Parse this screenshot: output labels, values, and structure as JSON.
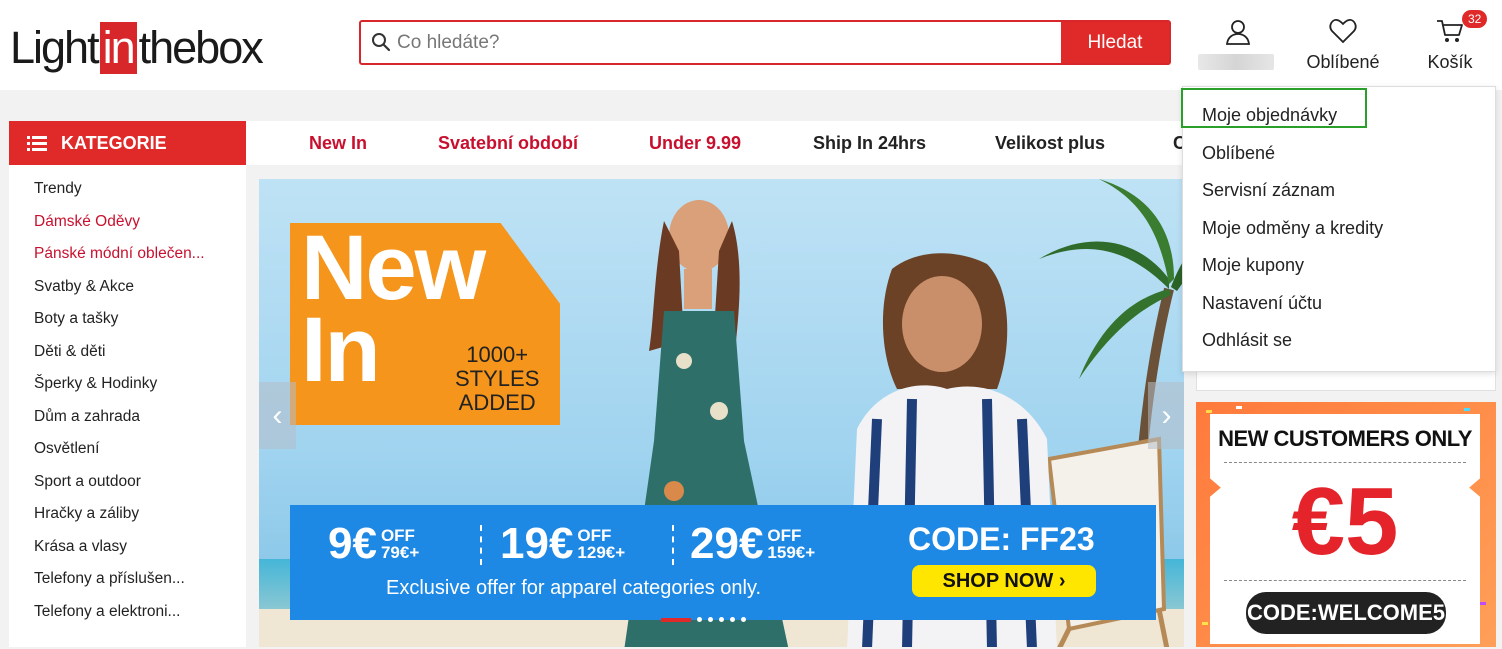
{
  "brand": {
    "logo_pre": "Light",
    "logo_box": "in",
    "logo_post": "thebox"
  },
  "search": {
    "placeholder": "Co hledáte?",
    "button": "Hledat"
  },
  "header_icons": {
    "account_label": "",
    "wishlist_label": "Oblíbené",
    "cart_label": "Košík",
    "cart_count": "32"
  },
  "categories": {
    "title": "KATEGORIE",
    "items": [
      {
        "label": "Trendy",
        "highlight": false
      },
      {
        "label": "Dámské Oděvy",
        "highlight": true
      },
      {
        "label": "Pánské módní oblečen...",
        "highlight": true
      },
      {
        "label": "Svatby & Akce",
        "highlight": false
      },
      {
        "label": "Boty a tašky",
        "highlight": false
      },
      {
        "label": "Děti & děti",
        "highlight": false
      },
      {
        "label": "Šperky & Hodinky",
        "highlight": false
      },
      {
        "label": "Dům a zahrada",
        "highlight": false
      },
      {
        "label": "Osvětlení",
        "highlight": false
      },
      {
        "label": "Sport a outdoor",
        "highlight": false
      },
      {
        "label": "Hračky a záliby",
        "highlight": false
      },
      {
        "label": "Krása a vlasy",
        "highlight": false
      },
      {
        "label": "Telefony a příslušen...",
        "highlight": false
      },
      {
        "label": "Telefony a elektroni...",
        "highlight": false
      }
    ]
  },
  "nav": {
    "items": [
      {
        "label": "New In",
        "red": true
      },
      {
        "label": "Svatební období",
        "red": true
      },
      {
        "label": "Under 9.99",
        "red": true
      },
      {
        "label": "Ship In 24hrs",
        "red": false
      },
      {
        "label": "Velikost plus",
        "red": false
      },
      {
        "label": "C",
        "red": false
      }
    ]
  },
  "account_menu": {
    "items": [
      "Moje objednávky",
      "Oblíbené",
      "Servisní záznam",
      "Moje odměny a kredity",
      "Moje kupony",
      "Nastavení účtu",
      "Odhlásit se"
    ],
    "selected_index": 0
  },
  "banner": {
    "headline_1": "New",
    "headline_2": "In",
    "styles_1": "1000+",
    "styles_2": "STYLES",
    "styles_3": "ADDED",
    "offers": [
      {
        "amount": "9€",
        "off": "OFF",
        "min": "79€+"
      },
      {
        "amount": "19€",
        "off": "OFF",
        "min": "129€+"
      },
      {
        "amount": "29€",
        "off": "OFF",
        "min": "159€+"
      }
    ],
    "code": "CODE: FF23",
    "cta": "SHOP NOW ›",
    "note": "Exclusive offer for apparel categories only.",
    "prev": "‹",
    "next": "›",
    "slide_count": 6,
    "active_slide": 0
  },
  "coupon": {
    "title": "NEW CUSTOMERS ONLY",
    "value": "€5",
    "code": "CODE:WELCOME5"
  },
  "colors": {
    "brand_red": "#e02a2a",
    "link_red": "#c8102e",
    "promo_blue": "#1e88e5",
    "orange": "#f5951b",
    "highlight_green": "#2aa02a"
  }
}
